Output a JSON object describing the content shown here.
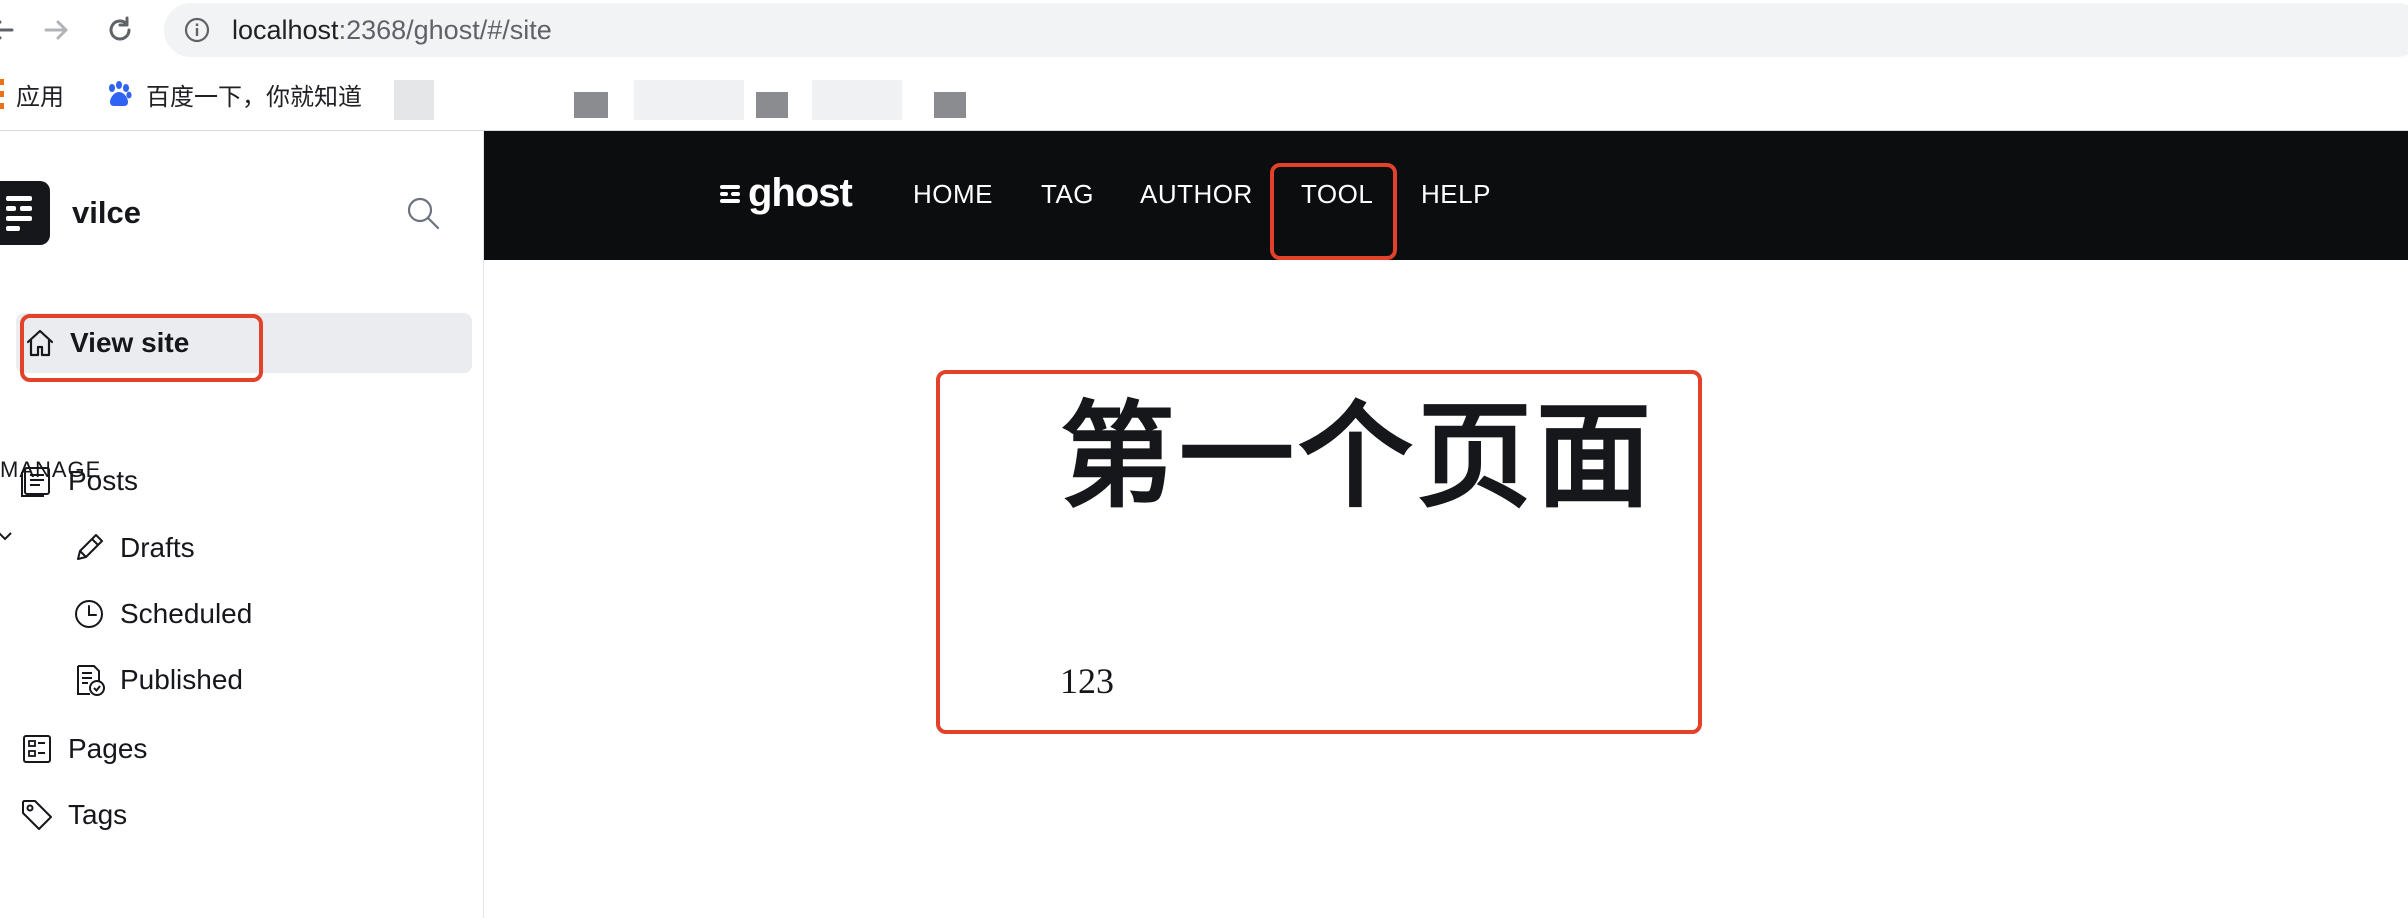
{
  "browser": {
    "url_host": "localhost",
    "url_rest": ":2368/ghost/#/site",
    "bookmarks": [
      {
        "label": "应用",
        "icon": "apps-icon"
      },
      {
        "label": "百度一下，你就知道",
        "icon": "baidu-paw-icon"
      }
    ]
  },
  "sidebar": {
    "site_name": "vilce",
    "view_site_label": "View site",
    "section_title": "MANAGE",
    "items": [
      {
        "label": "Posts",
        "icon": "posts-icon"
      },
      {
        "label": "Drafts",
        "icon": "pencil-icon"
      },
      {
        "label": "Scheduled",
        "icon": "clock-icon"
      },
      {
        "label": "Published",
        "icon": "published-icon"
      },
      {
        "label": "Pages",
        "icon": "pages-icon"
      },
      {
        "label": "Tags",
        "icon": "tag-icon"
      }
    ]
  },
  "blog": {
    "logo_text": "ghost",
    "nav": [
      {
        "label": "HOME"
      },
      {
        "label": "TAG"
      },
      {
        "label": "AUTHOR"
      },
      {
        "label": "TOOL"
      },
      {
        "label": "HELP"
      }
    ],
    "page_title": "第一个页面",
    "page_body": "123"
  },
  "colors": {
    "highlight": "#e2412a",
    "blog_header_bg": "#0c0d0f",
    "active_item_bg": "#eaecf0"
  }
}
